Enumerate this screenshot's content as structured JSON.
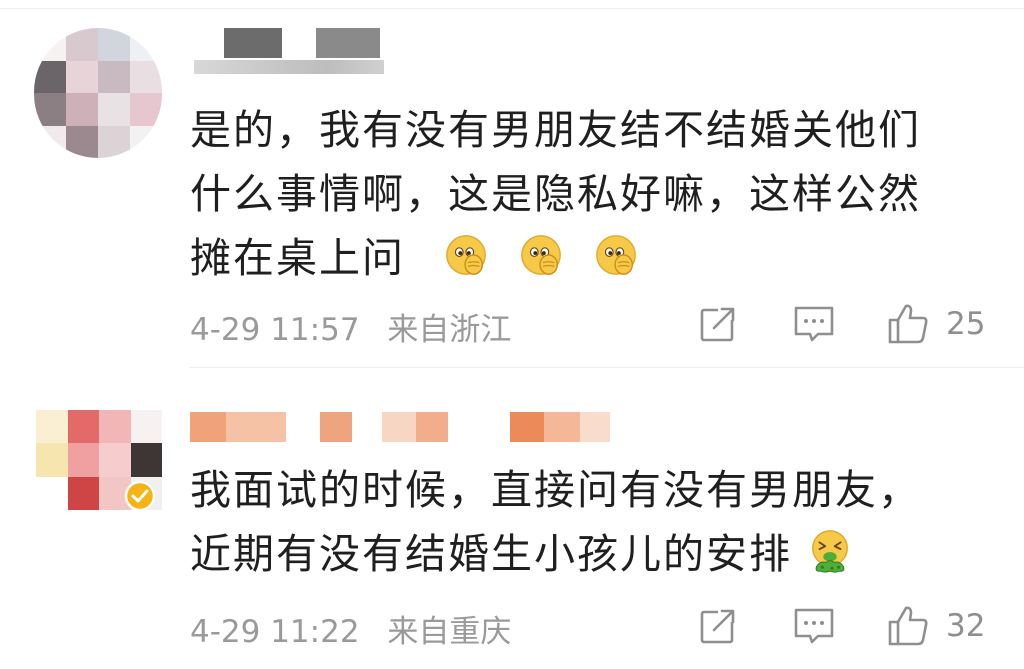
{
  "comments": [
    {
      "text_lines": [
        "是的，我有没有男朋友结不结婚关他们",
        "什么事情啊，这是隐私好嘛，这样公然",
        "摊在桌上问"
      ],
      "time": "4-29 11:57",
      "location": "来自浙江",
      "likes": "25",
      "emojis": [
        "shy-peek-emoji",
        "shy-peek-emoji",
        "shy-peek-emoji"
      ]
    },
    {
      "text_lines": [
        "我面试的时候，直接问有没有男朋友，",
        "近期有没有结婚生小孩儿的安排"
      ],
      "time": "4-29 11:22",
      "location": "来自重庆",
      "likes": "32",
      "emojis": [
        "vomit-emoji"
      ]
    }
  ],
  "icons": {
    "repost": "repost-icon",
    "comment": "comment-icon",
    "like": "thumbs-up-icon",
    "verified": "verified-badge-icon"
  },
  "colors": {
    "text": "#1f1f1f",
    "meta": "#9a9a9a",
    "icon": "#8f8f8f",
    "emoji_yellow": "#f7c948",
    "vomit_green": "#4fae3a"
  }
}
